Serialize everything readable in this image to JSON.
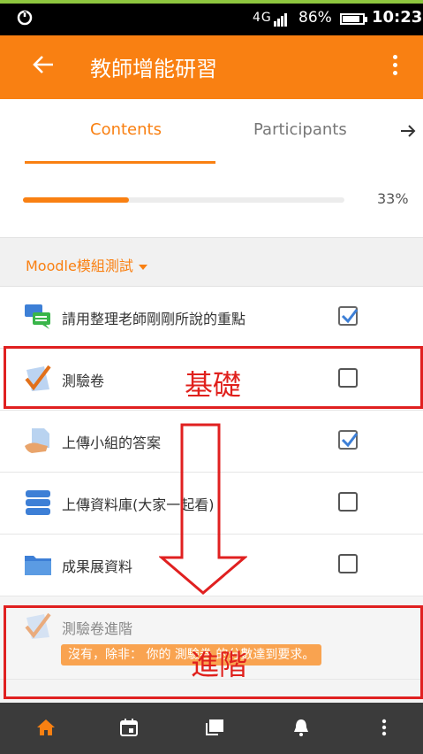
{
  "status_bar": {
    "network": "4G",
    "battery_percent": "86%",
    "time": "10:23"
  },
  "app_bar": {
    "title": "教師增能研習"
  },
  "tabs": {
    "contents": "Contents",
    "participants": "Participants"
  },
  "progress": {
    "value_percent": 33,
    "label": "33%"
  },
  "section": {
    "title": "Moodle模組測試"
  },
  "items": [
    {
      "label": "請用整理老師剛剛所說的重點",
      "icon": "forum-icon",
      "checked": true
    },
    {
      "label": "測驗卷",
      "icon": "quiz-icon",
      "checked": false
    },
    {
      "label": "上傳小組的答案",
      "icon": "assignment-icon",
      "checked": true
    },
    {
      "label": "上傳資料庫(大家一起看)",
      "icon": "database-icon",
      "checked": false
    },
    {
      "label": "成果展資料",
      "icon": "folder-icon",
      "checked": false
    },
    {
      "label": "測驗卷進階",
      "icon": "quiz-icon",
      "restriction": "沒有，除非： 你的 測驗卷 的分數達到要求。"
    }
  ],
  "annotations": {
    "basic": "基礎",
    "advanced": "進階"
  },
  "bottom_nav": [
    "home-icon",
    "calendar-icon",
    "messages-icon",
    "notifications-icon",
    "more-icon"
  ],
  "colors": {
    "accent": "#f98012",
    "annotation": "#e02020",
    "nav_bg": "#3b3b3b"
  }
}
